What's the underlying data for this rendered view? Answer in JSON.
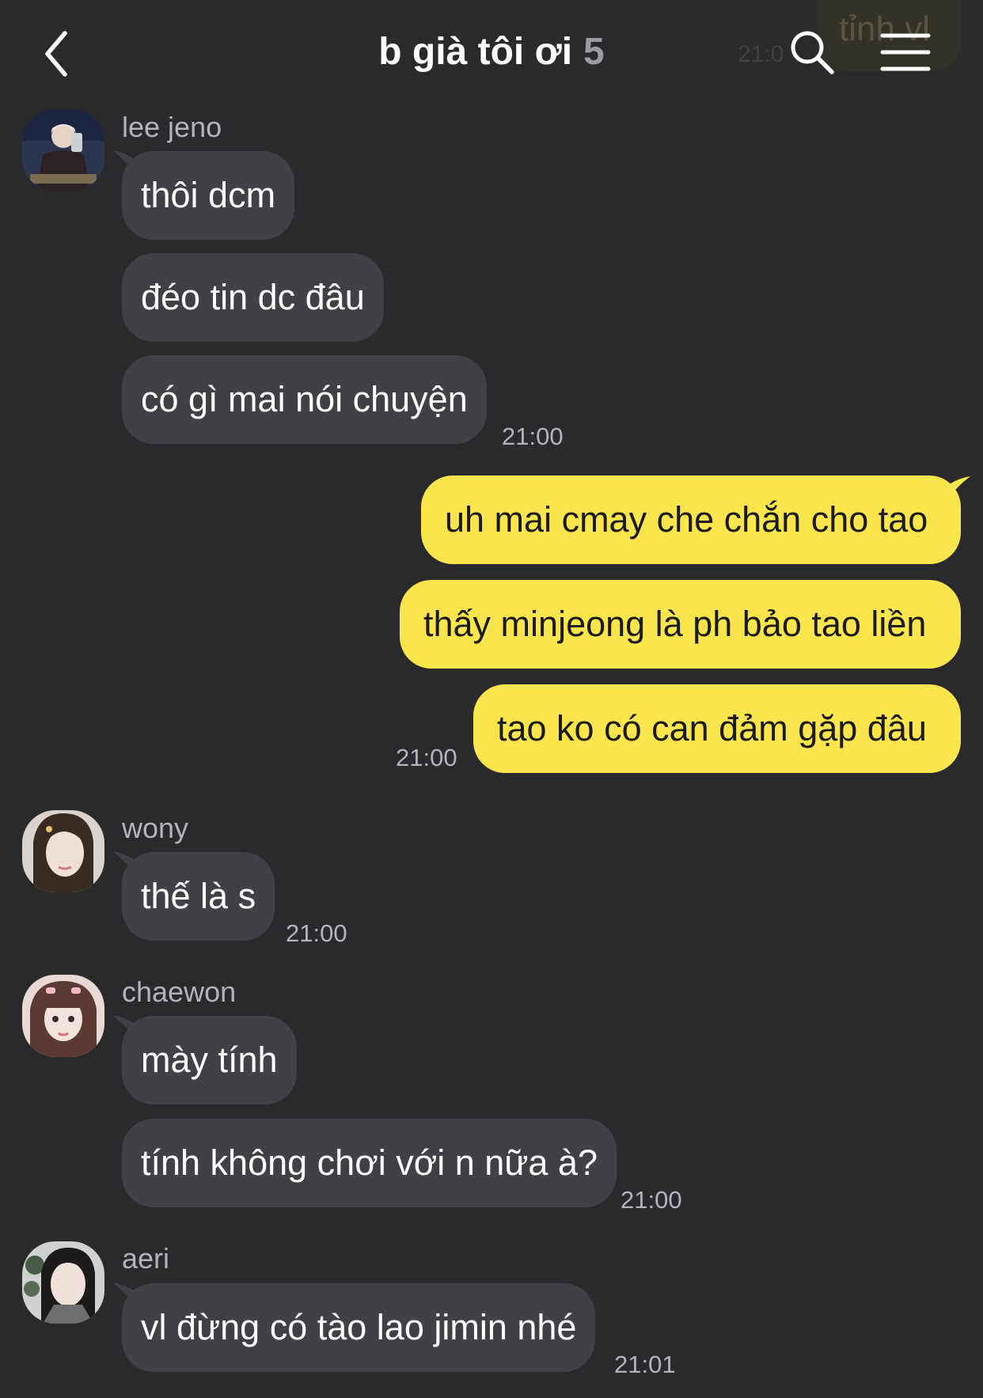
{
  "header": {
    "title": "b già tôi ơi",
    "member_count": "5",
    "back_icon": "chevron-left-icon",
    "search_icon": "search-icon",
    "menu_icon": "hamburger-menu-icon",
    "ghost_preview_text": "tỉnh vl",
    "ghost_preview_time": "21:0"
  },
  "colors": {
    "background": "#2a2a2d",
    "incoming_bubble": "#414145",
    "outgoing_bubble": "#fbe54d",
    "secondary_text": "#b3b3b8"
  },
  "groups": [
    {
      "sender": "lee jeno",
      "messages": [
        "thôi dcm",
        "đéo tin dc đâu",
        "có gì mai nói chuyện"
      ],
      "time": "21:00"
    },
    {
      "sender": "me",
      "messages": [
        "uh mai cmay che chắn cho tao",
        "thấy minjeong là ph bảo tao liền",
        "tao ko có can đảm gặp đâu"
      ],
      "time": "21:00"
    },
    {
      "sender": "wony",
      "messages": [
        "thế là s"
      ],
      "time": "21:00"
    },
    {
      "sender": "chaewon",
      "messages": [
        "mày tính",
        "tính không chơi với n nữa à?"
      ],
      "time": "21:00"
    },
    {
      "sender": "aeri",
      "messages": [
        "vl đừng có tào lao jimin nhé"
      ],
      "time": "21:01"
    }
  ]
}
